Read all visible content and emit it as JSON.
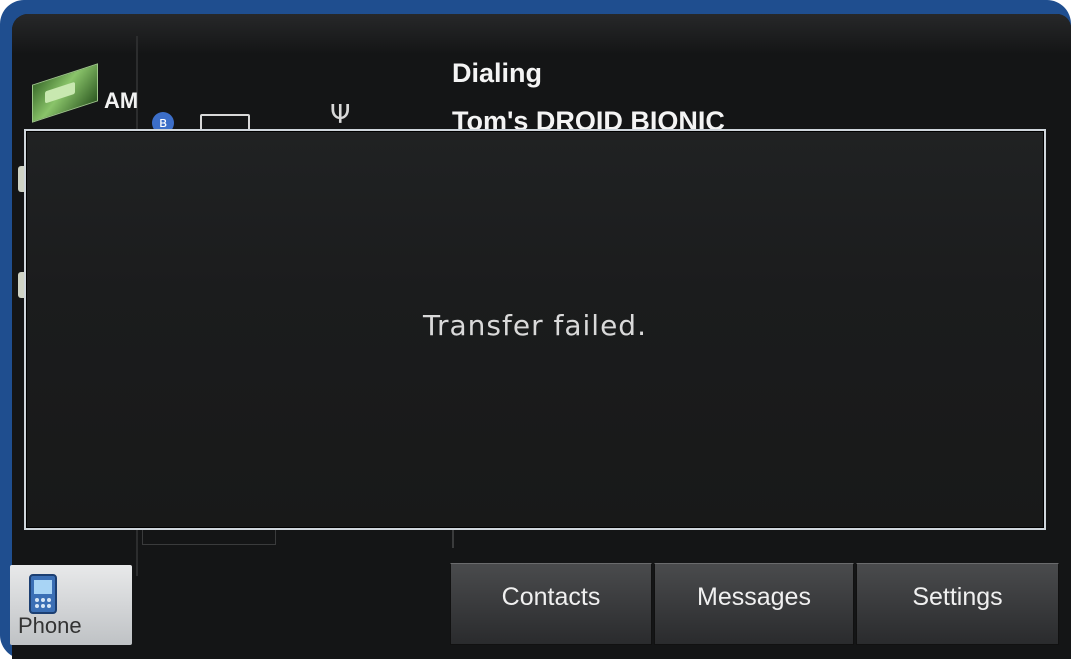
{
  "sidebar": {
    "items": [
      {
        "label": "AM",
        "icon": "am-radio-icon"
      },
      {
        "label": "Phone",
        "icon": "phone-icon"
      }
    ]
  },
  "status": {
    "icons": [
      "bluetooth-icon",
      "battery-icon",
      "signal-icon"
    ]
  },
  "call": {
    "status": "Dialing",
    "device": "Tom's DROID BIONIC"
  },
  "dialog": {
    "message": "Transfer failed."
  },
  "softkeys": [
    {
      "label": "Contacts"
    },
    {
      "label": "Messages"
    },
    {
      "label": "Settings"
    }
  ],
  "colors": {
    "frame": "#1f4e8f",
    "screen": "#141516",
    "dialog_border": "#cfd6dc"
  }
}
